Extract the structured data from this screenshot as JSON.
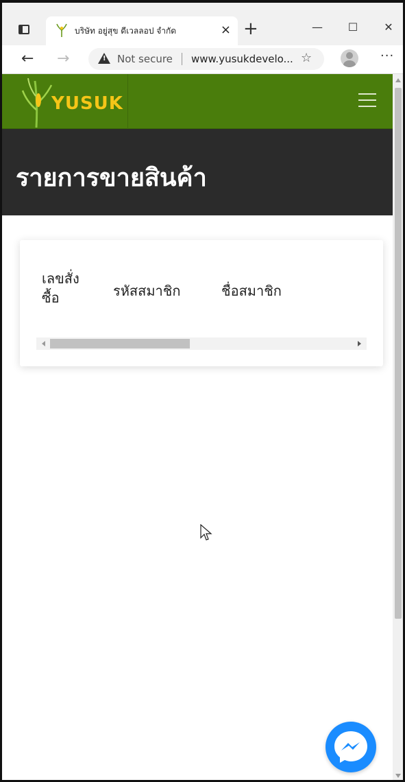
{
  "browser": {
    "tab_title": "บริษัท อยู่สุข ดีเวลลอป จำกัด",
    "tab_close": "×",
    "new_tab": "+",
    "minimize": "—",
    "maximize": "☐",
    "close": "✕",
    "back": "←",
    "forward": "→",
    "security_label": "Not secure",
    "url": "www.yusukdevelo...",
    "more": "···",
    "favorites_icon": "☆"
  },
  "site": {
    "logo_text": "YUSUK",
    "page_title": "รายการขายสินค้า",
    "brand_green": "#4a7d0c",
    "hero_bg": "#2b2b2b",
    "logo_color": "#f5c518"
  },
  "table": {
    "headers": [
      "เลขสั่งซื้อ",
      "รหัสสมาชิก",
      "ชื่อสมาชิก"
    ]
  },
  "chat": {
    "icon": "messenger-icon",
    "color": "#1a8cff"
  }
}
